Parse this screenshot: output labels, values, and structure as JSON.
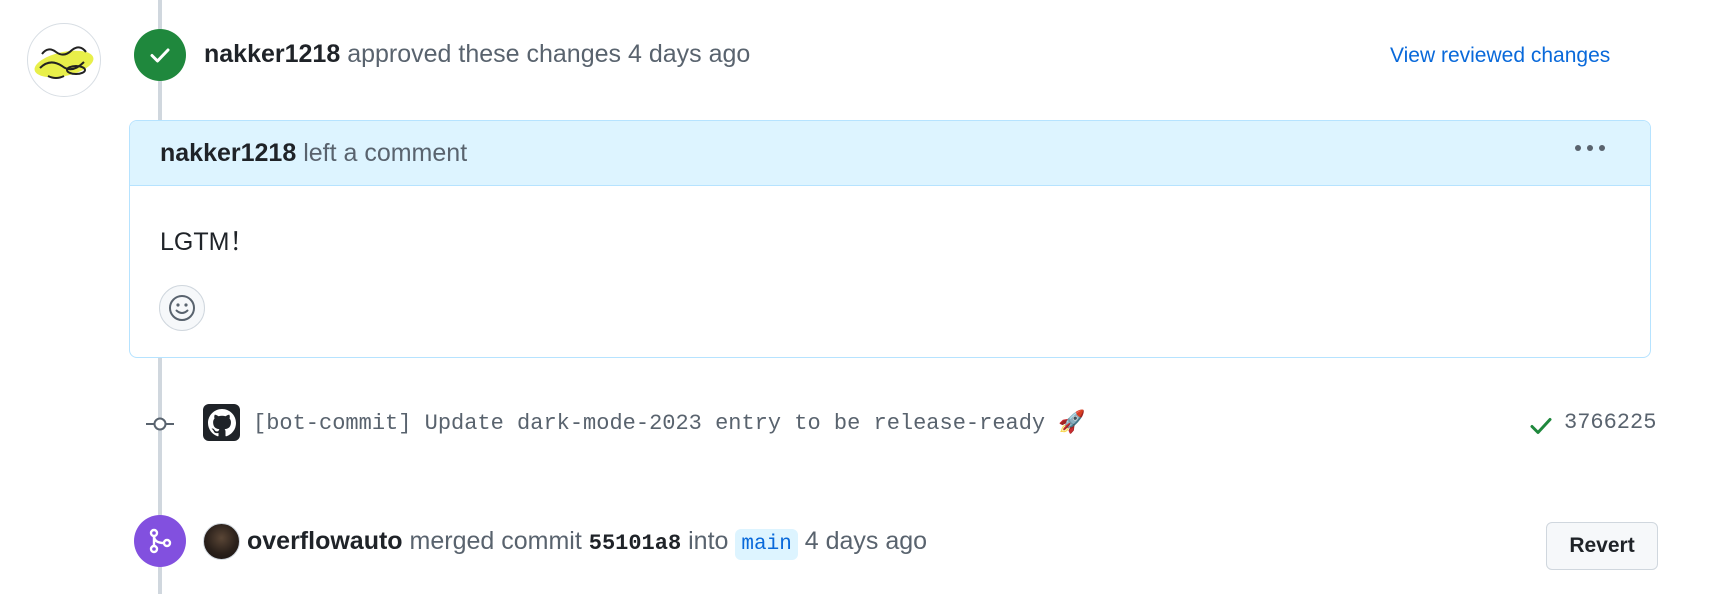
{
  "review_event": {
    "avatar_icon": "user-avatar-icon",
    "status_icon": "check-icon",
    "reviewer": "nakker1218",
    "action_text": "approved these changes",
    "time": "4 days ago",
    "view_link_label": "View reviewed changes",
    "color_approved": "#1f883d"
  },
  "comment": {
    "author": "nakker1218",
    "action_text": "left a comment",
    "body": "LGTM！",
    "menu_icon": "kebab-horizontal-icon",
    "reaction_icon": "smiley-icon",
    "header_bg": "#ddf4ff"
  },
  "commit_event": {
    "node_icon": "git-commit-icon",
    "avatar_icon": "github-logo-icon",
    "message": "[bot-commit] Update dark-mode-2023 entry to be release-ready 🚀",
    "status_icon": "check-icon",
    "sha": "3766225"
  },
  "merge_event": {
    "status_icon": "git-merge-icon",
    "user": "overflowauto",
    "action_text": "merged commit",
    "commit": "55101a8",
    "into_text": "into",
    "branch": "main",
    "time": "4 days ago",
    "revert_label": "Revert",
    "color_merged": "#8250df"
  }
}
